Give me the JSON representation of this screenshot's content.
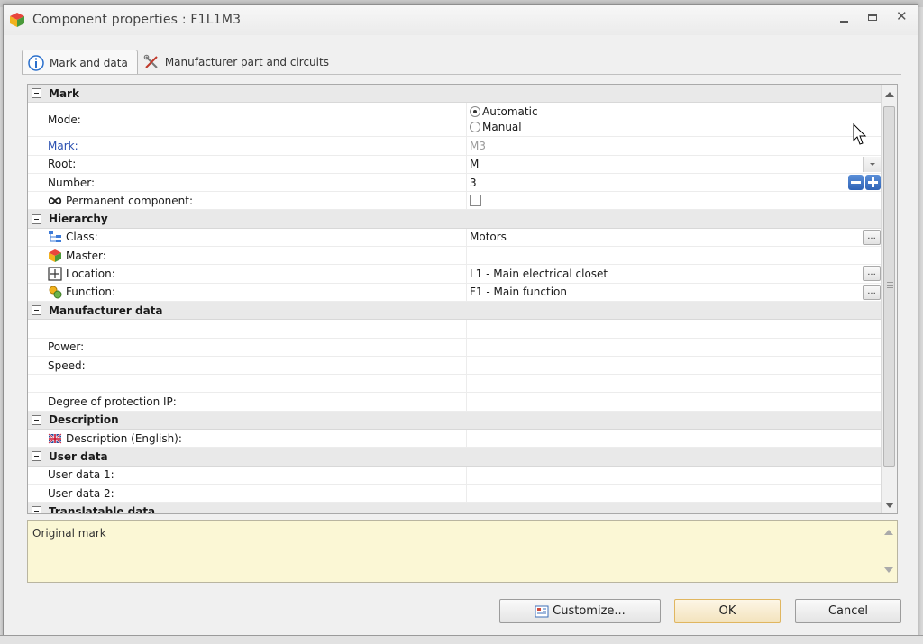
{
  "window": {
    "title": "Component properties : F1L1M3"
  },
  "tabs": [
    {
      "label": "Mark and data",
      "icon": "info-icon",
      "active": true
    },
    {
      "label": "Manufacturer part and circuits",
      "icon": "tools-icon",
      "active": false
    }
  ],
  "grid": {
    "mark": {
      "header": "Mark",
      "mode_label": "Mode:",
      "mode_options": [
        "Automatic",
        "Manual"
      ],
      "mode_selected": "Automatic",
      "mark_label": "Mark:",
      "mark_value": "M3",
      "root_label": "Root:",
      "root_value": "M",
      "number_label": "Number:",
      "number_value": "3",
      "permanent_label": "Permanent component:",
      "permanent_checked": false
    },
    "hierarchy": {
      "header": "Hierarchy",
      "class_label": "Class:",
      "class_value": "Motors",
      "master_label": "Master:",
      "master_value": "",
      "location_label": "Location:",
      "location_value": "L1 - Main electrical closet",
      "function_label": "Function:",
      "function_value": "F1 - Main function"
    },
    "manufacturer": {
      "header": "Manufacturer data",
      "power_label": "Power:",
      "speed_label": "Speed:",
      "ip_label": "Degree of protection IP:"
    },
    "description": {
      "header": "Description",
      "desc_label": "Description (English):"
    },
    "userdata": {
      "header": "User data",
      "user1_label": "User data 1:",
      "user2_label": "User data 2:"
    },
    "partial": {
      "header": "Translatable data"
    },
    "ellipsis": "..."
  },
  "description_box": {
    "text": "Original mark"
  },
  "buttons": {
    "customize": "Customize...",
    "ok": "OK",
    "cancel": "Cancel"
  },
  "colors": {
    "description_bg": "#fbf7d5",
    "category_bg": "#e9e9e9",
    "mark_label": "#2a4fb0",
    "ok_border": "#e0b660"
  }
}
